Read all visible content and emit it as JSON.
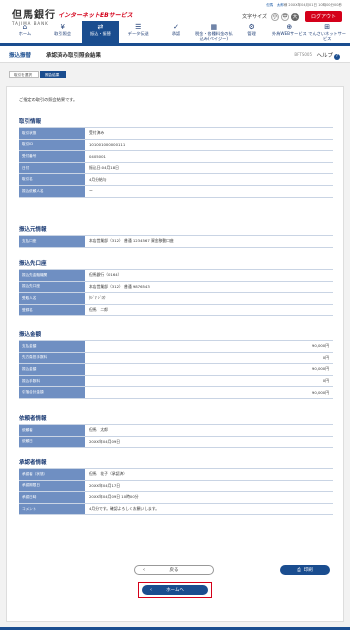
{
  "brand": {
    "logo": "但馬銀行",
    "logo_sub": "TAJIMA BANK",
    "service": "インターネットEBサービス"
  },
  "user": {
    "name": "但馬　太郎",
    "suffix": "様",
    "last_login": "20XX年04月01日 10時00分00秒"
  },
  "font_size": {
    "label": "文字サイズ",
    "small": "小",
    "medium": "中",
    "large": "大"
  },
  "logout": "ログアウト",
  "nav": [
    {
      "icon": "⌂",
      "label": "ホーム"
    },
    {
      "icon": "¥",
      "label": "取引照会"
    },
    {
      "icon": "⇄",
      "label": "振込・振替"
    },
    {
      "icon": "☰",
      "label": "データ伝送"
    },
    {
      "icon": "✓",
      "label": "承認"
    },
    {
      "icon": "▦",
      "label": "税金・各種料金の払込み(ペイジー)"
    },
    {
      "icon": "⚙",
      "label": "管理"
    },
    {
      "icon": "⊕",
      "label": "外為WEBサービス"
    },
    {
      "icon": "⊞",
      "label": "でんさいネットサービス"
    }
  ],
  "title": {
    "category": "振込振替",
    "main": "承認済み取引照会結果",
    "code": "BFTS005",
    "help": "ヘルプ",
    "help_icon": "?"
  },
  "steps": [
    "取引を選択",
    "照会結果"
  ],
  "message": "ご指定の取引の照会結果です。",
  "sections": [
    {
      "title": "取引情報",
      "rows": [
        {
          "k": "取引状態",
          "v": "受付済み"
        },
        {
          "k": "取引ID",
          "v": "101001000000111"
        },
        {
          "k": "受付番号",
          "v": "0405001"
        },
        {
          "k": "日付",
          "v": "振込日:04月18日"
        },
        {
          "k": "取引名",
          "v": "4月分給与"
        },
        {
          "k": "振込依頼人名",
          "v": "ー"
        }
      ]
    },
    {
      "title": "振込元情報",
      "rows": [
        {
          "k": "支払口座",
          "v": "本店営業部（312） 普通 1234567 資金移動口座"
        }
      ]
    },
    {
      "title": "振込先口座",
      "rows": [
        {
          "k": "振込先金融機関",
          "v": "但馬銀行（0164）"
        },
        {
          "k": "振込先口座",
          "v": "本店営業部（312） 普通 9876543"
        },
        {
          "k": "受取人名",
          "v": "ﾀｼﾞﾏ ｼﾞﾛｳ"
        },
        {
          "k": "登録名",
          "v": "但馬　二郎"
        }
      ]
    },
    {
      "title": "振込金額",
      "rows": [
        {
          "k": "支払金額",
          "v": "90,000円",
          "r": true
        },
        {
          "k": "先方負担手数料",
          "v": "0円",
          "r": true
        },
        {
          "k": "振込金額",
          "v": "90,000円",
          "r": true
        },
        {
          "k": "振込手数料",
          "v": "0円",
          "r": true
        },
        {
          "k": "引落合計金額",
          "v": "90,000円",
          "r": true
        }
      ]
    },
    {
      "title": "依頼者情報",
      "rows": [
        {
          "k": "依頼者",
          "v": "但馬　太郎"
        },
        {
          "k": "依頼日",
          "v": "20XX年04月09日"
        }
      ]
    },
    {
      "title": "承認者情報",
      "rows": [
        {
          "k": "承認者（状態）",
          "v": "但馬　花子（承認済）"
        },
        {
          "k": "承認期限日",
          "v": "20XX年04月17日"
        },
        {
          "k": "承認日時",
          "v": "20XX年04月09日 10時00分"
        },
        {
          "k": "コメント",
          "v": "4月分です。確認よろしくお願いします。"
        }
      ]
    }
  ],
  "buttons": {
    "back": "戻る",
    "print": "印刷",
    "home": "ホームへ"
  }
}
